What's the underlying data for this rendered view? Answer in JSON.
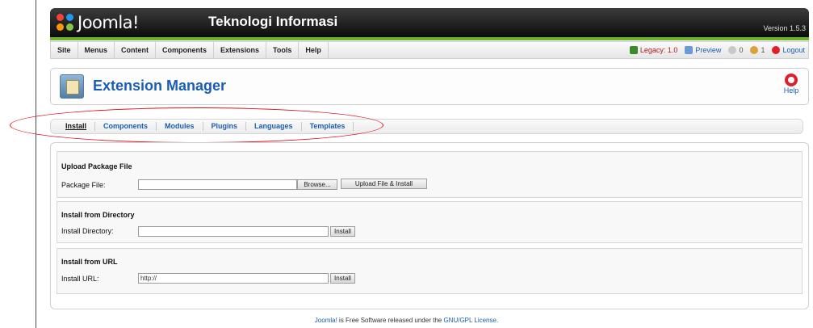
{
  "header": {
    "logo_text": "Joomla!",
    "site_title": "Teknologi Informasi",
    "version": "Version 1.5.3"
  },
  "menu": {
    "items": [
      "Site",
      "Menus",
      "Content",
      "Components",
      "Extensions",
      "Tools",
      "Help"
    ]
  },
  "status": {
    "legacy": "Legacy: 1.0",
    "preview": "Preview",
    "messages_count": "0",
    "users_count": "1",
    "logout": "Logout"
  },
  "toolbar": {
    "title": "Extension Manager",
    "help_label": "Help"
  },
  "submenu": {
    "items": [
      "Install",
      "Components",
      "Modules",
      "Plugins",
      "Languages",
      "Templates"
    ],
    "active": "Install"
  },
  "upload": {
    "legend": "Upload Package File",
    "label": "Package File:",
    "browse_label": "Browse...",
    "submit_label": "Upload File & Install"
  },
  "directory": {
    "legend": "Install from Directory",
    "label": "Install Directory:",
    "value": "",
    "submit_label": "Install"
  },
  "url": {
    "legend": "Install from URL",
    "label": "Install URL:",
    "value": "http://",
    "submit_label": "Install"
  },
  "footer": {
    "link1": "Joomla!",
    "text": " is Free Software released under the ",
    "link2": "GNU/GPL License",
    "end": "."
  },
  "colors": {
    "accent": "#1a5db5",
    "header_bg": "#0c0c0c",
    "green_bar": "#6bb12c",
    "highlight": "#e0101a"
  }
}
